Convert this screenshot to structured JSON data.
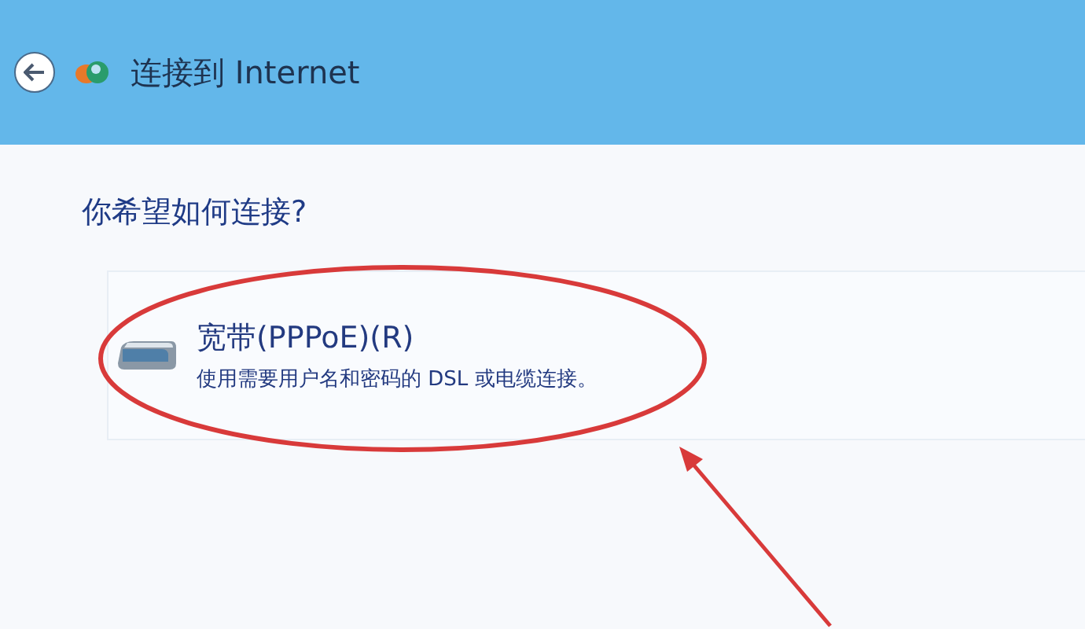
{
  "header": {
    "title": "连接到 Internet"
  },
  "question": "你希望如何连接?",
  "options": [
    {
      "title": "宽带(PPPoE)(R)",
      "description": "使用需要用户名和密码的 DSL 或电缆连接。"
    }
  ],
  "annotations": [
    {
      "kind": "ellipse"
    },
    {
      "kind": "arrow"
    }
  ]
}
